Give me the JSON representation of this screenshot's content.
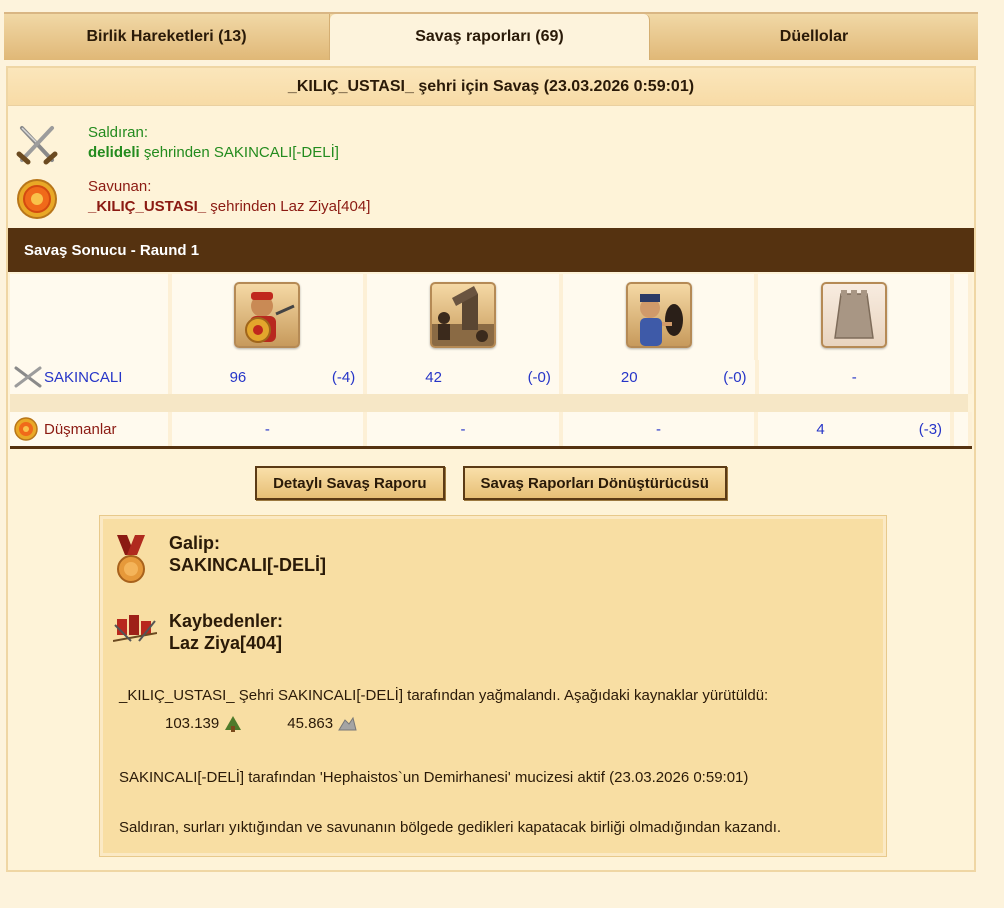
{
  "tabs": [
    {
      "label": "Birlik Hareketleri (13)"
    },
    {
      "label": "Savaş raporları (69)"
    },
    {
      "label": "Düellolar"
    }
  ],
  "report": {
    "title": "_KILIÇ_USTASI_ şehri için Savaş (23.03.2026 0:59:01)",
    "attacker_label": "Saldıran:",
    "attacker_city": "delideli",
    "attacker_rest": " şehrinden SAKINCALI[-DELİ]",
    "defender_label": "Savunan:",
    "defender_city": "_KILIÇ_USTASI_",
    "defender_rest": " şehrinden Laz Ziya[404]"
  },
  "result_bar": "Savaş Sonucu - Raund 1",
  "table": {
    "attacker_name": "SAKINCALI",
    "defender_name": "Düşmanlar",
    "attacker_row": [
      {
        "count": "96",
        "loss": "(-4)"
      },
      {
        "count": "42",
        "loss": "(-0)"
      },
      {
        "count": "20",
        "loss": "(-0)"
      },
      {
        "count": "-",
        "loss": ""
      }
    ],
    "defender_row": [
      {
        "count": "-",
        "loss": ""
      },
      {
        "count": "-",
        "loss": ""
      },
      {
        "count": "-",
        "loss": ""
      },
      {
        "count": "4",
        "loss": "(-3)"
      }
    ]
  },
  "buttons": {
    "detailed": "Detaylı Savaş Raporu",
    "converter": "Savaş Raporları Dönüştürücüsü"
  },
  "summary": {
    "winner_label": "Galip:",
    "winner_name": "SAKINCALI[-DELİ]",
    "losers_label": "Kaybedenler:",
    "losers_name": "Laz Ziya[404]",
    "plunder_text": "_KILIÇ_USTASI_ Şehri SAKINCALI[-DELİ] tarafından yağmalandı. Aşağıdaki kaynaklar yürütüldü:",
    "wood": "103.139",
    "stone": "45.863",
    "miracle_text": "SAKINCALI[-DELİ] tarafından 'Hephaistos`un Demirhanesi' mucizesi aktif (23.03.2026 0:59:01)",
    "reason_text": "Saldıran, surları yıktığından ve savunanın bölgede gedikleri kapatacak birliği olmadığından kazandı."
  }
}
